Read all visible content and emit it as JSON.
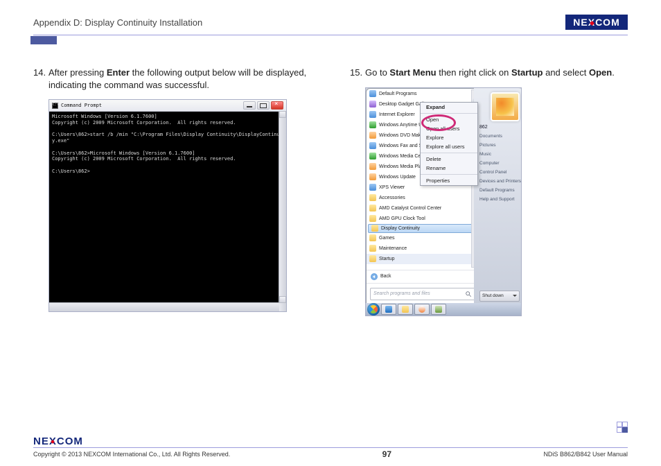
{
  "header": {
    "appendix_title": "Appendix D: Display Continuity Installation",
    "logo_text_left": "NE",
    "logo_text_x": "X",
    "logo_text_right": "COM"
  },
  "step14": {
    "num": "14.",
    "body_pre": "After pressing ",
    "bold1": "Enter",
    "body_mid": " the following output below will be displayed, indicating the command was successful."
  },
  "cmd": {
    "title": "Command Prompt",
    "line1": "Microsoft Windows [Version 6.1.7600]",
    "line2": "Copyright (c) 2009 Microsoft Corporation.  All rights reserved.",
    "line3": "",
    "line4": "C:\\Users\\862>start /b /min \"C:\\Program Files\\Display Continuity\\DisplayContinuit",
    "line5": "y.exe\"",
    "line6": "",
    "line7": "C:\\Users\\862>Microsoft Windows [Version 6.1.7600]",
    "line8": "Copyright (c) 2009 Microsoft Corporation.  All rights reserved.",
    "line9": "",
    "line10": "C:\\Users\\862>"
  },
  "step15": {
    "num": "15.",
    "pre": "Go to ",
    "b1": "Start Menu",
    "mid1": " then right click on ",
    "b2": "Startup",
    "mid2": " and select ",
    "b3": "Open",
    "post": "."
  },
  "sm": {
    "items": [
      "Default Programs",
      "Desktop Gadget Gallery",
      "Internet Explorer",
      "Windows Anytime Upgrade",
      "Windows DVD Maker",
      "Windows Fax and Scan",
      "Windows Media Center",
      "Windows Media Player",
      "Windows Update",
      "XPS Viewer",
      "Accessories",
      "AMD Catalyst Control Center",
      "AMD GPU Clock Tool",
      "Display Continuity",
      "Games",
      "Maintenance",
      "Startup"
    ],
    "back": "Back",
    "search_placeholder": "Search programs and files",
    "user": "862",
    "right_items": [
      "Documents",
      "Pictures",
      "Music",
      "Computer",
      "Control Panel",
      "Devices and Printers",
      "Default Programs",
      "Help and Support"
    ],
    "shutdown": "Shut down"
  },
  "ctx": {
    "expand": "Expand",
    "open": "Open",
    "open_all": "Open all users",
    "explore": "Explore",
    "explore_all": "Explore all users",
    "delete": "Delete",
    "rename": "Rename",
    "properties": "Properties"
  },
  "footer": {
    "copyright": "Copyright © 2013 NEXCOM International Co., Ltd. All Rights Reserved.",
    "page": "97",
    "manual": "NDiS B862/B842 User Manual"
  }
}
